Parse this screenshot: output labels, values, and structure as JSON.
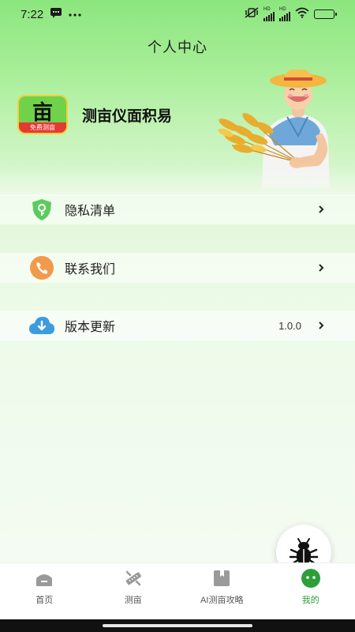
{
  "status_bar": {
    "time": "7:22",
    "notification_icons": [
      "message-icon",
      "more-icon"
    ],
    "system_icons": [
      "vibrate-off-icon",
      "signal-icon",
      "signal-icon",
      "wifi-icon",
      "battery-icon"
    ],
    "network_labels": [
      "HD",
      "HD"
    ],
    "battery_level": 1.0
  },
  "header": {
    "title": "个人中心"
  },
  "profile": {
    "logo_glyph": "亩",
    "logo_tag": "免费测亩",
    "app_name": "测亩仪面积易"
  },
  "menu": [
    {
      "label": "隐私清单",
      "icon": "privacy-shield-icon",
      "value": ""
    },
    {
      "label": "联系我们",
      "icon": "phone-icon",
      "value": ""
    },
    {
      "label": "版本更新",
      "icon": "cloud-download-icon",
      "value": "1.0.0"
    }
  ],
  "bottom_nav": [
    {
      "label": "首页",
      "icon": "home-icon",
      "active": false
    },
    {
      "label": "测亩",
      "icon": "measure-icon",
      "active": false
    },
    {
      "label": "AI测亩攻略",
      "icon": "guide-book-icon",
      "active": false
    },
    {
      "label": "我的",
      "icon": "profile-icon",
      "active": true
    }
  ],
  "colors": {
    "accent_green": "#2e9e3a",
    "header_green": "#8ce67e",
    "logo_red": "#e53935"
  }
}
